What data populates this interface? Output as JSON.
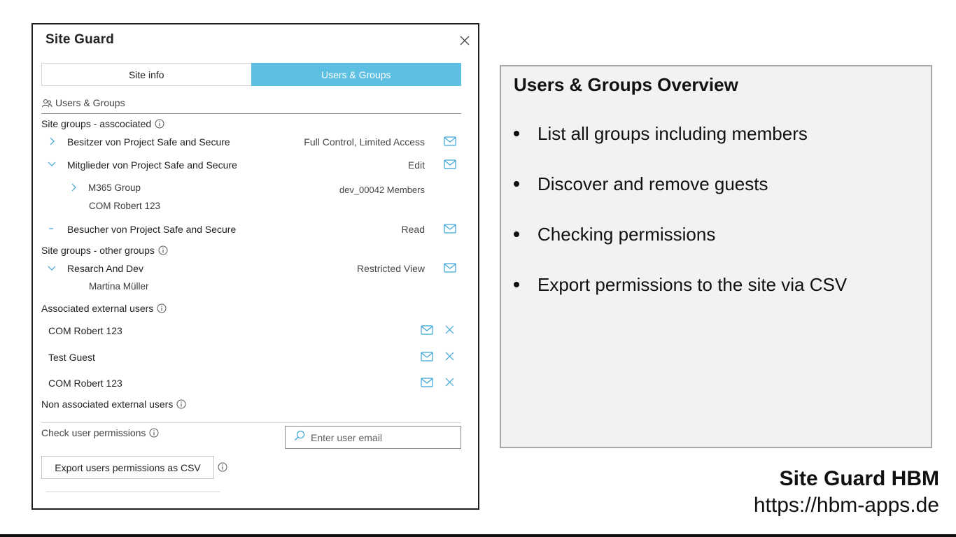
{
  "panel": {
    "title": "Site Guard",
    "tabs": [
      {
        "label": "Site info",
        "active": false
      },
      {
        "label": "Users & Groups",
        "active": true
      }
    ],
    "section_label": "Users & Groups",
    "site_groups_associated": {
      "label": "Site groups - asscociated",
      "groups": [
        {
          "name": "Besitzer von Project Safe and Secure",
          "permission": "Full Control, Limited Access",
          "state": "collapsed"
        },
        {
          "name": "Mitglieder von Project Safe and Secure",
          "permission": "Edit",
          "state": "expanded",
          "children": {
            "subgroup": "M365 Group",
            "subgroup_value": "dev_00042 Members",
            "member": "COM Robert 123"
          }
        },
        {
          "name": "Besucher von Project Safe and Secure",
          "permission": "Read",
          "state": "empty"
        }
      ]
    },
    "site_groups_other": {
      "label": "Site groups - other groups",
      "groups": [
        {
          "name": "Resarch And Dev",
          "permission": "Restricted View",
          "state": "expanded",
          "member": "Martina Müller"
        }
      ]
    },
    "associated_external": {
      "label": "Associated external users",
      "users": [
        "COM Robert 123",
        "Test Guest",
        "COM Robert 123"
      ]
    },
    "non_associated_external": {
      "label": "Non associated external users"
    },
    "check_permissions": {
      "label": "Check user permissions",
      "placeholder": "Enter user email"
    },
    "export_button": "Export users permissions as CSV"
  },
  "overview": {
    "title": "Users & Groups Overview",
    "bullets": [
      "List all groups including members",
      "Discover and remove guests",
      "Checking permissions",
      "Export permissions to the site via CSV"
    ]
  },
  "brand": {
    "name": "Site Guard HBM",
    "url": "https://hbm-apps.de"
  },
  "colors": {
    "accent": "#5dc0e3",
    "mail_icon": "#3aa3d6",
    "border": "#1f1f1f",
    "overview_bg": "#f2f2f2"
  }
}
